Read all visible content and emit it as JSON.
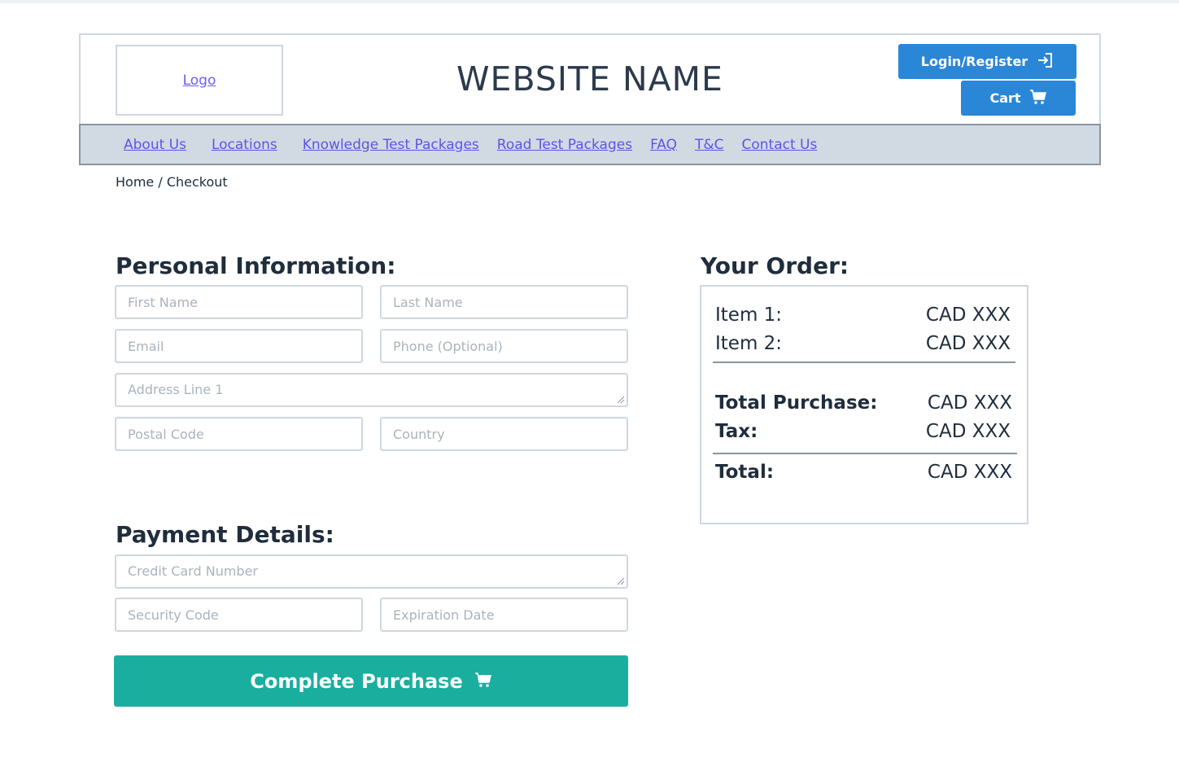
{
  "header": {
    "logo_label": "Logo",
    "site_name": "WEBSITE NAME",
    "login_label": "Login/Register",
    "cart_label": "Cart"
  },
  "nav": {
    "items": [
      "About Us",
      "Locations",
      "Knowledge Test Packages",
      "Road Test Packages",
      "FAQ",
      "T&C",
      "Contact Us"
    ]
  },
  "breadcrumb": "Home / Checkout",
  "personal": {
    "title": "Personal Information:",
    "first_name": "First Name",
    "last_name": "Last Name",
    "email": "Email",
    "phone": "Phone (Optional)",
    "address": "Address Line 1",
    "postal": "Postal Code",
    "country": "Country"
  },
  "payment": {
    "title": "Payment Details:",
    "card": "Credit Card Number",
    "security": "Security Code",
    "expiration": "Expiration Date"
  },
  "order": {
    "title": "Your Order:",
    "items": [
      {
        "label": "Item 1:",
        "value": "CAD XXX"
      },
      {
        "label": "Item 2:",
        "value": "CAD XXX"
      }
    ],
    "total_purchase": {
      "label": "Total Purchase:",
      "value": "CAD XXX"
    },
    "tax": {
      "label": "Tax:",
      "value": "CAD XXX"
    },
    "total": {
      "label": "Total:",
      "value": "CAD XXX"
    }
  },
  "purchase_button": "Complete Purchase",
  "colors": {
    "primary_blue": "#2a87d8",
    "teal": "#1aae9f",
    "link": "#5b55e8",
    "nav_bg": "#d1dae2"
  },
  "icons": {
    "login": "login-arrow-icon",
    "cart": "shopping-cart-icon"
  }
}
